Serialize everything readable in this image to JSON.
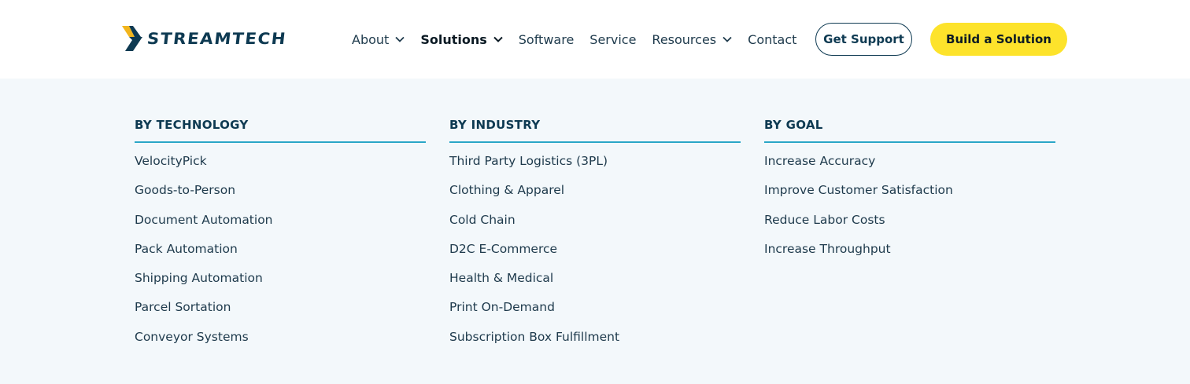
{
  "header": {
    "logo_text": "STREAMTECH",
    "logo_icon": "chevron-logo-icon",
    "nav": [
      {
        "label": "About",
        "has_dropdown": true,
        "active": false
      },
      {
        "label": "Solutions",
        "has_dropdown": true,
        "active": true
      },
      {
        "label": "Software",
        "has_dropdown": false,
        "active": false
      },
      {
        "label": "Service",
        "has_dropdown": false,
        "active": false
      },
      {
        "label": "Resources",
        "has_dropdown": true,
        "active": false
      },
      {
        "label": "Contact",
        "has_dropdown": false,
        "active": false
      }
    ],
    "support_label": "Get Support",
    "build_label": "Build a Solution"
  },
  "mega_menu": {
    "columns": [
      {
        "title": "BY TECHNOLOGY",
        "links": [
          "VelocityPick",
          "Goods-to-Person",
          "Document Automation",
          "Pack Automation",
          "Shipping Automation",
          "Parcel Sortation",
          "Conveyor Systems"
        ]
      },
      {
        "title": "BY INDUSTRY",
        "links": [
          "Third Party Logistics (3PL)",
          "Clothing & Apparel",
          "Cold Chain",
          "D2C E-Commerce",
          "Health & Medical",
          "Print On-Demand",
          "Subscription Box Fulfillment"
        ]
      },
      {
        "title": "BY GOAL",
        "links": [
          "Increase Accuracy",
          "Improve Customer Satisfaction",
          "Reduce Labor Costs",
          "Increase Throughput"
        ]
      }
    ]
  },
  "colors": {
    "brand_navy": "#0e3a52",
    "accent_yellow": "#fde32b",
    "accent_teal": "#2aa6c7",
    "menu_background": "#f3f8fb"
  }
}
